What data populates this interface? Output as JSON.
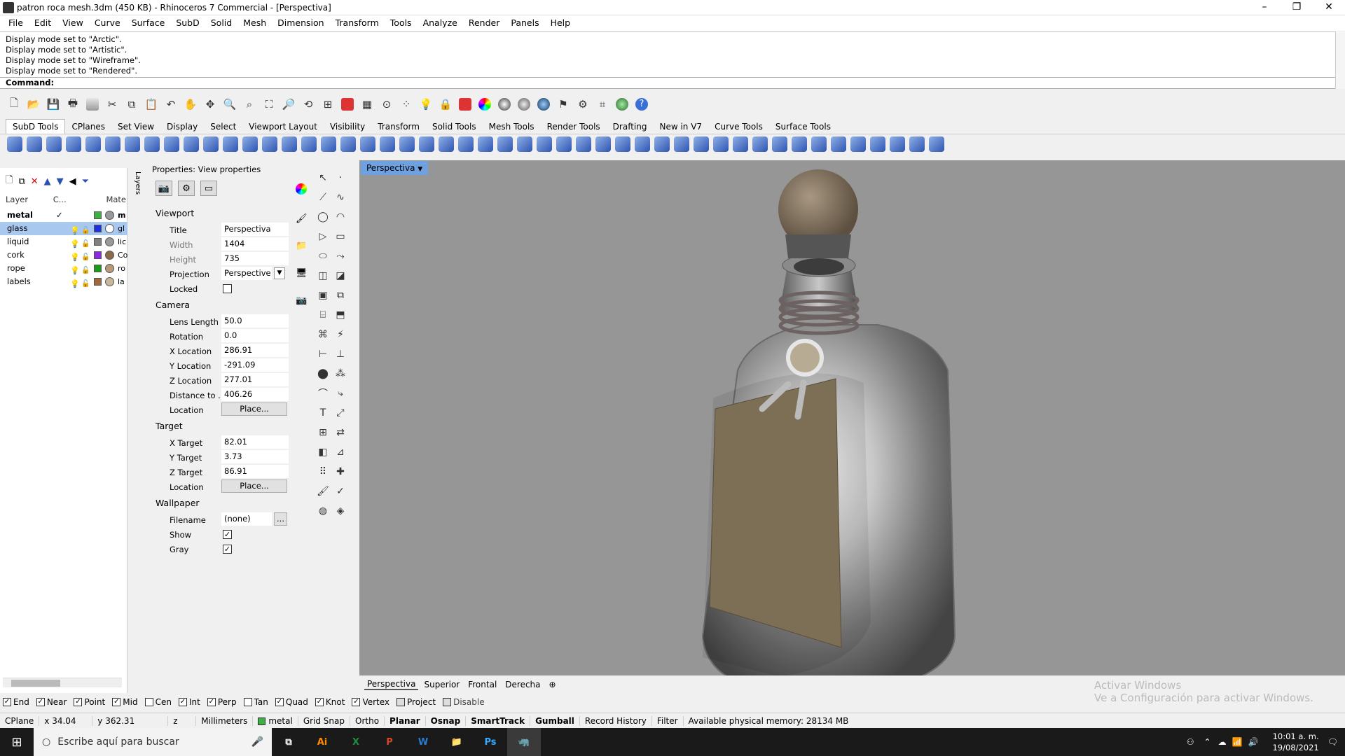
{
  "window": {
    "title": "patron roca mesh.3dm (450 KB) - Rhinoceros 7 Commercial - [Perspectiva]",
    "min": "–",
    "max": "❐",
    "close": "✕"
  },
  "menu": [
    "File",
    "Edit",
    "View",
    "Curve",
    "Surface",
    "SubD",
    "Solid",
    "Mesh",
    "Dimension",
    "Transform",
    "Tools",
    "Analyze",
    "Render",
    "Panels",
    "Help"
  ],
  "history": [
    "Display mode set to \"Arctic\".",
    "Display mode set to \"Artistic\".",
    "Display mode set to \"Wireframe\".",
    "Display mode set to \"Rendered\"."
  ],
  "command_label": "Command:",
  "toolbar_tabs": [
    "SubD Tools",
    "CPlanes",
    "Set View",
    "Display",
    "Select",
    "Viewport Layout",
    "Visibility",
    "Transform",
    "Solid Tools",
    "Mesh Tools",
    "Render Tools",
    "Drafting",
    "New in V7",
    "Curve Tools",
    "Surface Tools"
  ],
  "layers": {
    "headers": [
      "Layer",
      "C...",
      "Mate"
    ],
    "rows": [
      {
        "name": "metal",
        "color": "#3cb043",
        "mat": "m",
        "current": "✓"
      },
      {
        "name": "glass",
        "color": "#2030e0",
        "mat": "gl",
        "current": ""
      },
      {
        "name": "liquid",
        "color": "#808080",
        "mat": "lic",
        "current": ""
      },
      {
        "name": "cork",
        "color": "#8a2be2",
        "mat": "Co",
        "current": ""
      },
      {
        "name": "rope",
        "color": "#1a9a1a",
        "mat": "ro",
        "current": ""
      },
      {
        "name": "labels",
        "color": "#a0683c",
        "mat": "la",
        "current": ""
      }
    ],
    "vtab": "Layers"
  },
  "props": {
    "header": "Properties: View properties",
    "viewport": {
      "section": "Viewport",
      "title_label": "Title",
      "title": "Perspectiva",
      "width_label": "Width",
      "width": "1404",
      "height_label": "Height",
      "height": "735",
      "projection_label": "Projection",
      "projection": "Perspective",
      "locked_label": "Locked"
    },
    "camera": {
      "section": "Camera",
      "lens_label": "Lens Length",
      "lens": "50.0",
      "rot_label": "Rotation",
      "rot": "0.0",
      "xl_label": "X Location",
      "xl": "286.91",
      "yl_label": "Y Location",
      "yl": "-291.09",
      "zl_label": "Z Location",
      "zl": "277.01",
      "dist_label": "Distance to ...",
      "dist": "406.26",
      "loc_label": "Location",
      "loc_btn": "Place..."
    },
    "target": {
      "section": "Target",
      "xt_label": "X Target",
      "xt": "82.01",
      "yt_label": "Y Target",
      "yt": "3.73",
      "zt_label": "Z Target",
      "zt": "86.91",
      "loc_label": "Location",
      "loc_btn": "Place..."
    },
    "wallpaper": {
      "section": "Wallpaper",
      "file_label": "Filename",
      "file": "(none)",
      "file_btn": "...",
      "show_label": "Show",
      "gray_label": "Gray"
    }
  },
  "viewport": {
    "active_tab": "Perspectiva",
    "tabs": [
      "Perspectiva",
      "Superior",
      "Frontal",
      "Derecha"
    ],
    "add": "⊕",
    "watermark1": "Activar Windows",
    "watermark2": "Ve a Configuración para activar Windows."
  },
  "osnaps": [
    {
      "label": "End",
      "checked": true
    },
    {
      "label": "Near",
      "checked": true
    },
    {
      "label": "Point",
      "checked": true
    },
    {
      "label": "Mid",
      "checked": true
    },
    {
      "label": "Cen",
      "checked": false
    },
    {
      "label": "Int",
      "checked": true
    },
    {
      "label": "Perp",
      "checked": true
    },
    {
      "label": "Tan",
      "checked": false
    },
    {
      "label": "Quad",
      "checked": true
    },
    {
      "label": "Knot",
      "checked": true
    },
    {
      "label": "Vertex",
      "checked": true
    },
    {
      "label": "Project",
      "checked": false
    },
    {
      "label": "Disable",
      "checked": false
    }
  ],
  "status": {
    "cplane": "CPlane",
    "x": "x 34.04",
    "y": "y 362.31",
    "z": "z",
    "units": "Millimeters",
    "layer": "metal",
    "layer_color": "#3cb043",
    "grid": "Grid Snap",
    "ortho": "Ortho",
    "planar": "Planar",
    "osnap": "Osnap",
    "smarttrack": "SmartTrack",
    "gumball": "Gumball",
    "record": "Record History",
    "filter": "Filter",
    "memory": "Available physical memory: 28134 MB"
  },
  "taskbar": {
    "search": "Escribe aquí para buscar",
    "time": "10:01 a. m.",
    "date": "19/08/2021",
    "apps": [
      "Ai",
      "X",
      "P",
      "W",
      "📁",
      "Ps",
      "🦏"
    ]
  }
}
